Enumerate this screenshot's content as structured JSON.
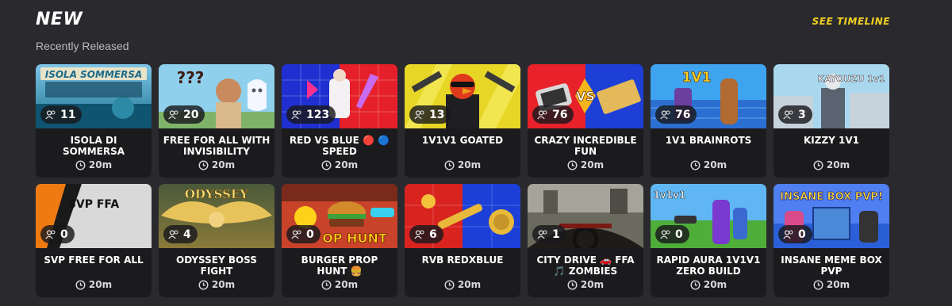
{
  "section": {
    "title": "NEW",
    "subtitle": "Recently Released",
    "timeline_label": "SEE TIMELINE"
  },
  "colors": {
    "accent": "#f2d022",
    "background": "#2a2a2e",
    "card": "#1b1b1e"
  },
  "icons": {
    "players": "players-icon",
    "clock": "clock-icon"
  },
  "cards": [
    {
      "title": "ISOLA DI SOMMERSA",
      "players": "11",
      "duration": "20m",
      "thumb_text": "ISOLA SOMMERSA"
    },
    {
      "title": "FREE FOR ALL WITH INVISIBILITY",
      "players": "20",
      "duration": "20m",
      "thumb_text": "???"
    },
    {
      "title": "RED VS BLUE 🔴 🔵 SPEED",
      "players": "123",
      "duration": "20m",
      "thumb_text": ""
    },
    {
      "title": "1V1V1 GOATED",
      "players": "13",
      "duration": "20m",
      "thumb_text": ""
    },
    {
      "title": "CRAZY INCREDIBLE FUN",
      "players": "76",
      "duration": "20m",
      "thumb_text": "VS"
    },
    {
      "title": "1V1 BRAINROTS",
      "players": "76",
      "duration": "20m",
      "thumb_text": "1V1"
    },
    {
      "title": "KIZZY 1V1",
      "players": "3",
      "duration": "20m",
      "thumb_text": "KAYOUZU 1v1"
    },
    {
      "title": "SVP FREE FOR ALL",
      "players": "0",
      "duration": "20m",
      "thumb_text": "SVP FFA"
    },
    {
      "title": "ODYSSEY BOSS FIGHT",
      "players": "4",
      "duration": "20m",
      "thumb_text": "ODYSSEY"
    },
    {
      "title": "BURGER PROP HUNT 🍔",
      "players": "0",
      "duration": "20m",
      "thumb_text": "OP HUNT"
    },
    {
      "title": "RVB REDXBLUE",
      "players": "6",
      "duration": "20m",
      "thumb_text": ""
    },
    {
      "title": "CITY DRIVE 🚗 FFA 🎵 ZOMBIES",
      "players": "1",
      "duration": "20m",
      "thumb_text": ""
    },
    {
      "title": "RAPID AURA 1V1V1 ZERO BUILD",
      "players": "0",
      "duration": "20m",
      "thumb_text": "1v1v1"
    },
    {
      "title": "INSANE MEME BOX PVP",
      "players": "0",
      "duration": "20m",
      "thumb_text": "INSANE BOX PVP!"
    }
  ]
}
